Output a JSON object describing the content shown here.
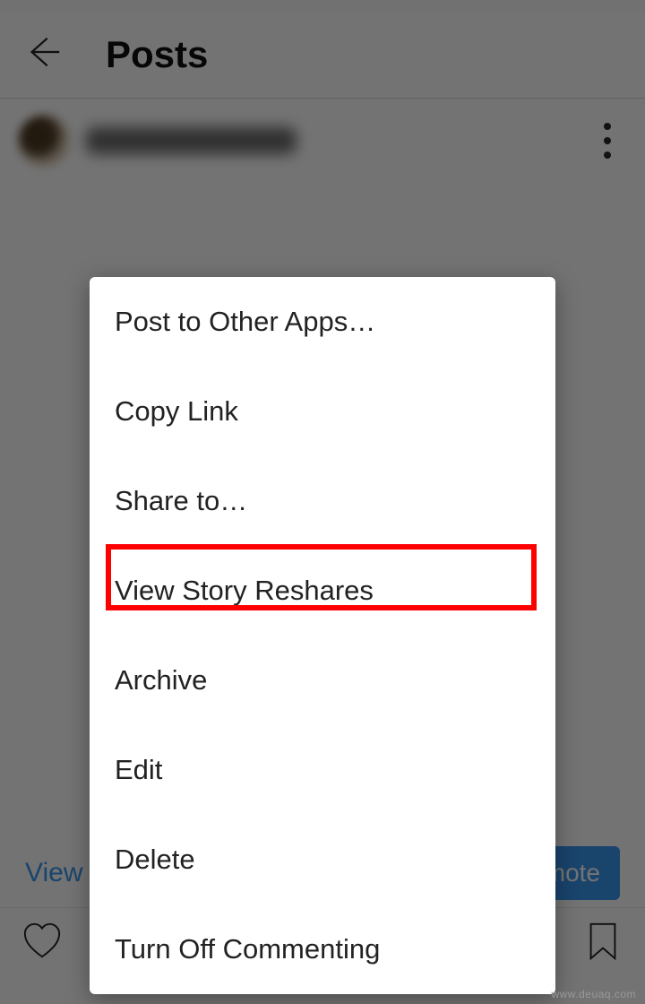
{
  "header": {
    "title": "Posts"
  },
  "insights": {
    "view_label": "View Insights",
    "promote_label": "Promote"
  },
  "menu": {
    "items": [
      "Post to Other Apps…",
      "Copy Link",
      "Share to…",
      "View Story Reshares",
      "Archive",
      "Edit",
      "Delete",
      "Turn Off Commenting"
    ],
    "highlight_index": 3
  },
  "watermark": "www.deuaq.com"
}
